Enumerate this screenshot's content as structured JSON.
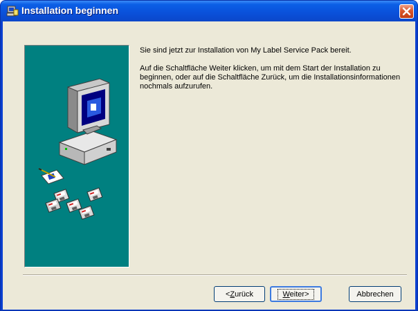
{
  "window": {
    "title": "Installation beginnen",
    "titlebar_color": "#0a50da",
    "close_color": "#d8562c"
  },
  "icons": {
    "title": "installer-icon",
    "close": "close-icon",
    "illustration": "computer-with-disks-illustration"
  },
  "side_panel": {
    "color": "#008080"
  },
  "content": {
    "line1": "Sie sind jetzt zur Installation von My Label Service Pack bereit.",
    "line2": "Auf die Schaltfläche Weiter klicken, um mit dem Start der Installation zu beginnen, oder auf die Schaltfläche Zurück, um die Installationsinformationen nochmals aufzurufen."
  },
  "buttons": {
    "back": {
      "prefix": "<",
      "mnemonic": "Z",
      "rest": "urück"
    },
    "next": {
      "mnemonic": "W",
      "rest": "eiter>"
    },
    "cancel": "Abbrechen"
  }
}
